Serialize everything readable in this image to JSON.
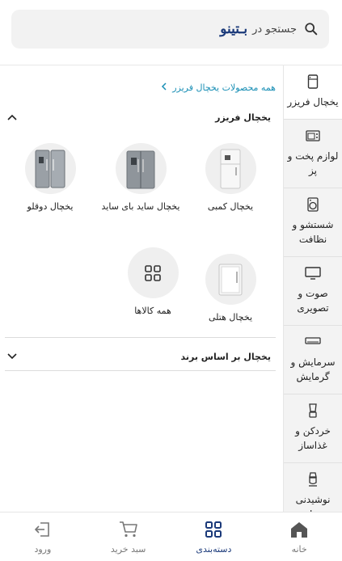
{
  "search": {
    "placeholder": "جستجو در",
    "brand": "بـتینو"
  },
  "sidebar": {
    "items": [
      {
        "label": "یخچال فریزر",
        "icon": "fridge-icon"
      },
      {
        "label": "لوازم پخت و پز",
        "icon": "oven-icon"
      },
      {
        "label": "شستشو و نظافت",
        "icon": "washing-machine-icon"
      },
      {
        "label": "صوت و تصویری",
        "icon": "tv-icon"
      },
      {
        "label": "سرمایش و گرمایش",
        "icon": "air-conditioner-icon"
      },
      {
        "label": "خردکن و غذاساز",
        "icon": "blender-icon"
      },
      {
        "label": "نوشیدنی ساز",
        "icon": "coffee-maker-icon"
      }
    ]
  },
  "breadcrumb": {
    "label": "همه محصولات یخچال فریزر"
  },
  "sections": {
    "fridge": {
      "title": "یخچال فریزر",
      "items": [
        {
          "label": "یخچال کمبی"
        },
        {
          "label": "یخچال ساید بای ساید"
        },
        {
          "label": "یخچال دوقلو"
        },
        {
          "label": "یخچال هتلی"
        },
        {
          "label": "همه کالاها"
        }
      ]
    },
    "brand": {
      "title": "یخچال بر اساس برند"
    }
  },
  "bottom_nav": {
    "home": "خانه",
    "categories": "دسته‌بندی",
    "cart": "سبد خرید",
    "login": "ورود"
  },
  "colors": {
    "brand": "#1b3a7a",
    "link": "#1a8fb5",
    "sidebar_bg": "#f3f3f3"
  }
}
